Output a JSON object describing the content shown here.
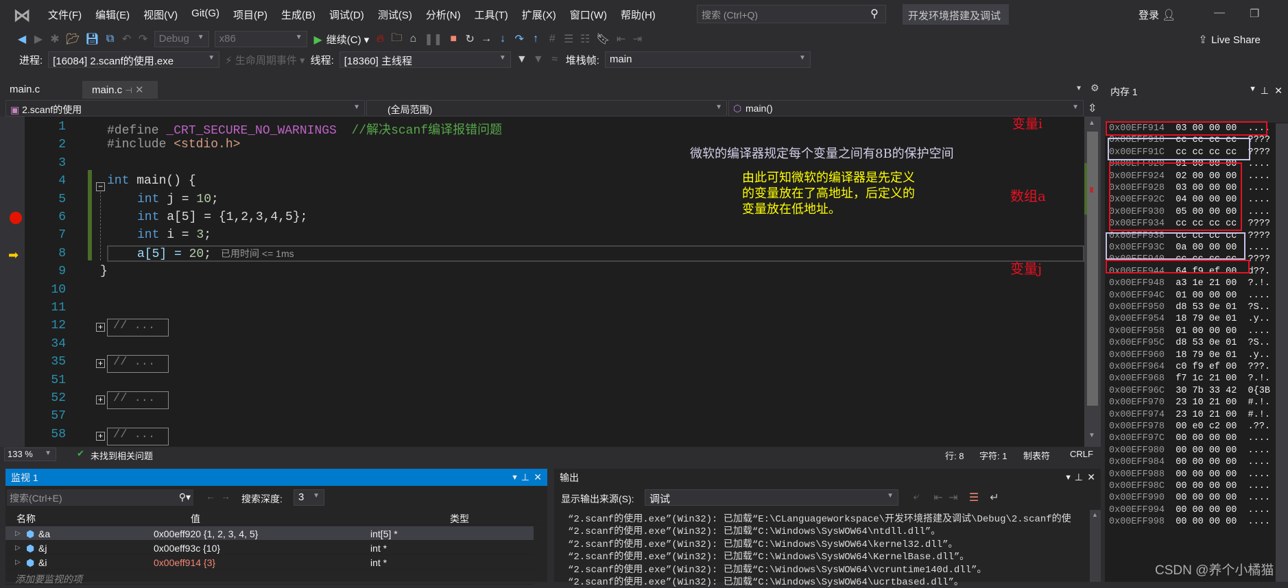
{
  "menu": {
    "items": [
      "文件(F)",
      "编辑(E)",
      "视图(V)",
      "Git(G)",
      "项目(P)",
      "生成(B)",
      "调试(D)",
      "测试(S)",
      "分析(N)",
      "工具(T)",
      "扩展(X)",
      "窗口(W)",
      "帮助(H)"
    ],
    "search_placeholder": "搜索 (Ctrl+Q)",
    "solution_name": "开发环境搭建及调试",
    "login": "登录"
  },
  "toolbar": {
    "config": "Debug",
    "platform": "x86",
    "continue": "继续(C)",
    "live_share": "Live Share"
  },
  "debugbar": {
    "process_label": "进程:",
    "process": "[16084] 2.scanf的使用.exe",
    "lifecycle": "生命周期事件",
    "thread_label": "线程:",
    "thread": "[18360] 主线程",
    "stack_label": "堆栈帧:",
    "stack": "main"
  },
  "tabs": [
    {
      "label": "main.c"
    },
    {
      "label": "main.c"
    }
  ],
  "nav": {
    "project": "2.scanf的使用",
    "scope": "(全局范围)",
    "function": "main()"
  },
  "editor": {
    "line_numbers": [
      "1",
      "2",
      "3",
      "4",
      "5",
      "6",
      "7",
      "8",
      "9",
      "10",
      "11",
      "12",
      "34",
      "35",
      "51",
      "52",
      "57",
      "58"
    ],
    "lines": {
      "l1a": "#define ",
      "l1b": "_CRT_SECURE_NO_WARNINGS",
      "l1c": "  //解决scanf编译报错问题",
      "l2a": "#include ",
      "l2b": "<stdio.h>",
      "l4a": "int",
      " l4b": " main() {",
      "l5a": "int",
      "l5b": " j = ",
      "l5c": "10",
      "l6a": "int",
      "l6b": " a[5] = {1,2,3,4,5};",
      "l7a": "int",
      "l7b": " i = ",
      "l7c": "3",
      "l7d": ";",
      "l5d": ";",
      "l8a": "a[5] = ",
      "l8b": "20",
      "l8c": ";",
      "l9": "}",
      "fold": "// ..."
    },
    "elapsed": "已用时间 <= 1ms"
  },
  "annotations": {
    "var_i": "变量i",
    "note1": "微软的编译器规定每个变量之间有8B的保护空间",
    "note2": "由此可知微软的编译器是先定义\n的变量放在了高地址，后定义的\n变量放在低地址。",
    "array_a": "数组a",
    "var_j": "变量j"
  },
  "status": {
    "zoom": "133 %",
    "issues": "未找到相关问题",
    "line": "行: 8",
    "col": "字符: 1",
    "tabs": "制表符",
    "eol": "CRLF"
  },
  "watch": {
    "title": "监视 1",
    "search_placeholder": "搜索(Ctrl+E)",
    "depth_label": "搜索深度:",
    "depth": "3",
    "headers": [
      "名称",
      "值",
      "类型"
    ],
    "rows": [
      {
        "name": "&a",
        "value": "0x00eff920 {1, 2, 3, 4, 5}",
        "type": "int[5] *",
        "changed": false
      },
      {
        "name": "&j",
        "value": "0x00eff93c {10}",
        "type": "int *",
        "changed": false
      },
      {
        "name": "&i",
        "value": "0x00eff914 {3}",
        "type": "int *",
        "changed": true
      }
    ],
    "add_placeholder": "添加要监视的项"
  },
  "output": {
    "title": "输出",
    "source_label": "显示输出来源(S):",
    "source": "调试",
    "lines": [
      "“2.scanf的使用.exe”(Win32): 已加载“E:\\CLanguageworkspace\\开发环境搭建及调试\\Debug\\2.scanf的使",
      "“2.scanf的使用.exe”(Win32): 已加载“C:\\Windows\\SysWOW64\\ntdll.dll”。",
      "“2.scanf的使用.exe”(Win32): 已加载“C:\\Windows\\SysWOW64\\kernel32.dll”。",
      "“2.scanf的使用.exe”(Win32): 已加载“C:\\Windows\\SysWOW64\\KernelBase.dll”。",
      "“2.scanf的使用.exe”(Win32): 已加载“C:\\Windows\\SysWOW64\\vcruntime140d.dll”。",
      "“2.scanf的使用.exe”(Win32): 已加载“C:\\Windows\\SysWOW64\\ucrtbased.dll”。"
    ]
  },
  "memory": {
    "title": "内存 1",
    "rows": [
      [
        "0x00EFF914",
        "03 00 00 00",
        "...."
      ],
      [
        "0x00EFF918",
        "cc cc cc cc",
        "????"
      ],
      [
        "0x00EFF91C",
        "cc cc cc cc",
        "????"
      ],
      [
        "0x00EFF920",
        "01 00 00 00",
        "...."
      ],
      [
        "0x00EFF924",
        "02 00 00 00",
        "...."
      ],
      [
        "0x00EFF928",
        "03 00 00 00",
        "...."
      ],
      [
        "0x00EFF92C",
        "04 00 00 00",
        "...."
      ],
      [
        "0x00EFF930",
        "05 00 00 00",
        "...."
      ],
      [
        "0x00EFF934",
        "cc cc cc cc",
        "????"
      ],
      [
        "0x00EFF938",
        "cc cc cc cc",
        "????"
      ],
      [
        "0x00EFF93C",
        "0a 00 00 00",
        "...."
      ],
      [
        "0x00EFF940",
        "cc cc cc cc",
        "????"
      ],
      [
        "0x00EFF944",
        "64 f9 ef 00",
        "d??."
      ],
      [
        "0x00EFF948",
        "a3 1e 21 00",
        "?.!."
      ],
      [
        "0x00EFF94C",
        "01 00 00 00",
        "...."
      ],
      [
        "0x00EFF950",
        "d8 53 0e 01",
        "?S.."
      ],
      [
        "0x00EFF954",
        "18 79 0e 01",
        ".y.."
      ],
      [
        "0x00EFF958",
        "01 00 00 00",
        "...."
      ],
      [
        "0x00EFF95C",
        "d8 53 0e 01",
        "?S.."
      ],
      [
        "0x00EFF960",
        "18 79 0e 01",
        ".y.."
      ],
      [
        "0x00EFF964",
        "c0 f9 ef 00",
        "???."
      ],
      [
        "0x00EFF968",
        "f7 1c 21 00",
        "?.!."
      ],
      [
        "0x00EFF96C",
        "30 7b 33 42",
        "0{3B"
      ],
      [
        "0x00EFF970",
        "23 10 21 00",
        "#.!."
      ],
      [
        "0x00EFF974",
        "23 10 21 00",
        "#.!."
      ],
      [
        "0x00EFF978",
        "00 e0 c2 00",
        ".??."
      ],
      [
        "0x00EFF97C",
        "00 00 00 00",
        "...."
      ],
      [
        "0x00EFF980",
        "00 00 00 00",
        "...."
      ],
      [
        "0x00EFF984",
        "00 00 00 00",
        "...."
      ],
      [
        "0x00EFF988",
        "00 00 00 00",
        "...."
      ],
      [
        "0x00EFF98C",
        "00 00 00 00",
        "...."
      ],
      [
        "0x00EFF990",
        "00 00 00 00",
        "...."
      ],
      [
        "0x00EFF994",
        "00 00 00 00",
        "...."
      ],
      [
        "0x00EFF998",
        "00 00 00 00",
        "...."
      ]
    ]
  },
  "watermark": "CSDN @养个小橘猫",
  "colors": {
    "accent": "#007acc",
    "annotation_red": "#e81123",
    "annotation_yellow": "#ffff00",
    "breakpoint": "#e51400"
  }
}
